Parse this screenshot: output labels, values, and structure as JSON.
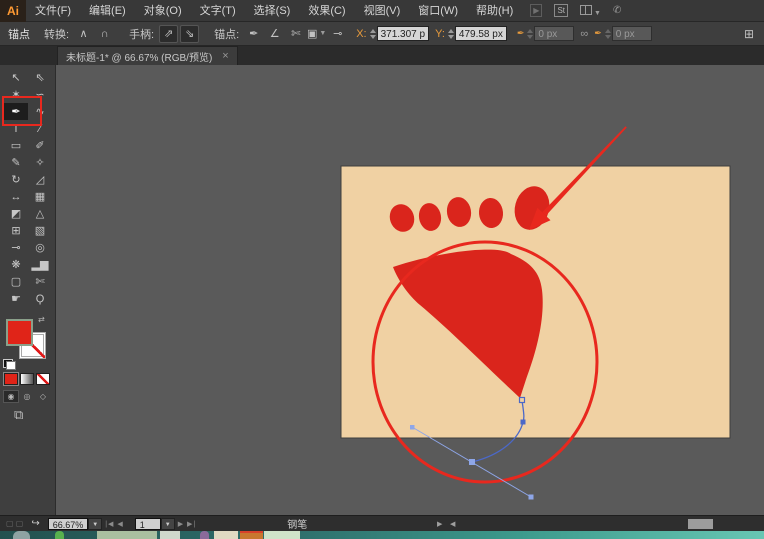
{
  "app": {
    "logo_label": "Ai",
    "stock_label": "St"
  },
  "menubar": {
    "items": [
      "文件(F)",
      "编辑(E)",
      "对象(O)",
      "文字(T)",
      "选择(S)",
      "效果(C)",
      "视图(V)",
      "窗口(W)",
      "帮助(H)"
    ]
  },
  "controlbar": {
    "panel_label": "锚点",
    "convert_label": "转换:",
    "handles_label": "手柄:",
    "anchors_label": "锚点:",
    "x_label": "X:",
    "x_value": "371.307 p",
    "y_label": "Y:",
    "y_value": "479.58 px",
    "w_value": "0 px",
    "h_value": "0 px"
  },
  "tabbar": {
    "title": "未标题-1* @ 66.67% (RGB/预览)",
    "close_label": "×"
  },
  "toolbar": {
    "tools": [
      {
        "name": "selection-tool",
        "glyph": "↖"
      },
      {
        "name": "direct-selection-tool",
        "glyph": "⇖"
      },
      {
        "name": "magic-wand-tool",
        "glyph": "✶"
      },
      {
        "name": "lasso-tool",
        "glyph": "∽"
      },
      {
        "name": "pen-tool",
        "glyph": "✒"
      },
      {
        "name": "curvature-tool",
        "glyph": "∿"
      },
      {
        "name": "type-tool",
        "glyph": "T"
      },
      {
        "name": "line-segment-tool",
        "glyph": "∕"
      },
      {
        "name": "rectangle-tool",
        "glyph": "▭"
      },
      {
        "name": "paintbrush-tool",
        "glyph": "✐"
      },
      {
        "name": "pencil-tool",
        "glyph": "✎"
      },
      {
        "name": "shaper-tool",
        "glyph": "✧"
      },
      {
        "name": "rotate-tool",
        "glyph": "↻"
      },
      {
        "name": "scale-tool",
        "glyph": "◿"
      },
      {
        "name": "width-tool",
        "glyph": "↔"
      },
      {
        "name": "free-transform-tool",
        "glyph": "▦"
      },
      {
        "name": "shape-builder-tool",
        "glyph": "◩"
      },
      {
        "name": "perspective-grid-tool",
        "glyph": "△"
      },
      {
        "name": "mesh-tool",
        "glyph": "⊞"
      },
      {
        "name": "gradient-tool",
        "glyph": "▧"
      },
      {
        "name": "eyedropper-tool",
        "glyph": "⊸"
      },
      {
        "name": "blend-tool",
        "glyph": "◎"
      },
      {
        "name": "symbol-sprayer-tool",
        "glyph": "❋"
      },
      {
        "name": "graph-tool",
        "glyph": "▂▆"
      },
      {
        "name": "artboard-tool",
        "glyph": "▢"
      },
      {
        "name": "slice-tool",
        "glyph": "✄"
      },
      {
        "name": "hand-tool",
        "glyph": "☛"
      },
      {
        "name": "zoom-tool",
        "glyph": "Ϙ"
      }
    ]
  },
  "statusbar": {
    "zoom_value": "66.67%",
    "artboard_value": "1",
    "tool_name": "钢笔"
  },
  "colors": {
    "artboard_tan": "#f0d1a3",
    "artwork_red": "#da251c",
    "annotation_red": "#e8281e",
    "path_blue": "#4b68c8",
    "handle_blue": "#8ea6e8",
    "fill_swatch_red": "#e02418",
    "taskbar_teal": "#2e6e6b"
  }
}
